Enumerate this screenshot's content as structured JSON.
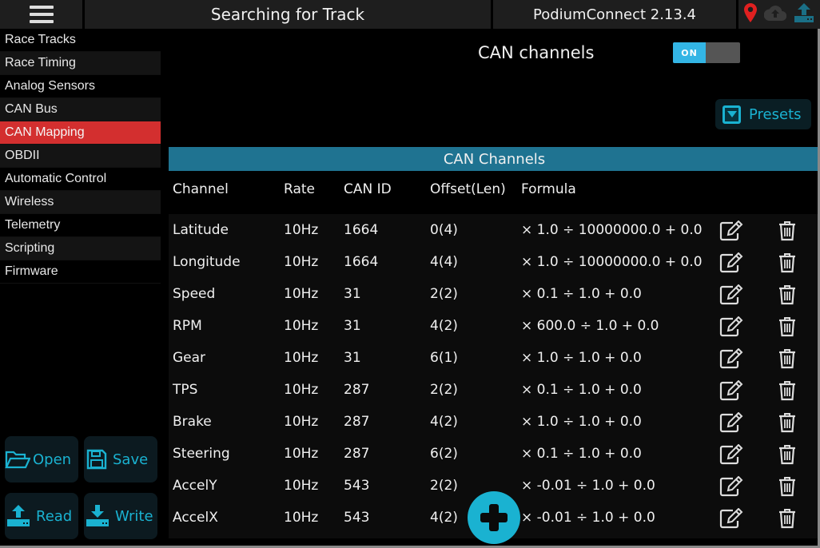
{
  "topbar": {
    "menu_icon": "hamburger-menu-icon",
    "title": "Searching for Track",
    "app_version": "PodiumConnect 2.13.4",
    "status_icons": [
      {
        "name": "location-pin-icon",
        "color": "#e02020"
      },
      {
        "name": "cloud-upload-icon",
        "color": "#3a3a3a"
      },
      {
        "name": "upload-icon",
        "color": "#1a6f86"
      }
    ]
  },
  "sidebar": {
    "items": [
      {
        "label": "Race Tracks",
        "active": false
      },
      {
        "label": "Race Timing",
        "active": false
      },
      {
        "label": "Analog Sensors",
        "active": false
      },
      {
        "label": "CAN Bus",
        "active": false
      },
      {
        "label": "CAN Mapping",
        "active": true
      },
      {
        "label": "OBDII",
        "active": false
      },
      {
        "label": "Automatic Control",
        "active": false
      },
      {
        "label": "Wireless",
        "active": false
      },
      {
        "label": "Telemetry",
        "active": false
      },
      {
        "label": "Scripting",
        "active": false
      },
      {
        "label": "Firmware",
        "active": false
      }
    ],
    "buttons": {
      "open": "Open",
      "save": "Save",
      "read": "Read",
      "write": "Write"
    }
  },
  "main": {
    "can_channels_label": "CAN channels",
    "toggle": {
      "label": "ON",
      "state": true
    },
    "presets_label": "Presets",
    "panel_title": "CAN Channels",
    "columns": {
      "channel": "Channel",
      "rate": "Rate",
      "can_id": "CAN ID",
      "offset": "Offset(Len)",
      "formula": "Formula"
    },
    "rows": [
      {
        "channel": "Latitude",
        "rate": "10Hz",
        "can_id": "1664",
        "offset": "0(4)",
        "formula": "× 1.0 ÷ 10000000.0 + 0.0"
      },
      {
        "channel": "Longitude",
        "rate": "10Hz",
        "can_id": "1664",
        "offset": "4(4)",
        "formula": "× 1.0 ÷ 10000000.0 + 0.0"
      },
      {
        "channel": "Speed",
        "rate": "10Hz",
        "can_id": "31",
        "offset": "2(2)",
        "formula": "× 0.1 ÷ 1.0 + 0.0"
      },
      {
        "channel": "RPM",
        "rate": "10Hz",
        "can_id": "31",
        "offset": "4(2)",
        "formula": "× 600.0 ÷ 1.0 + 0.0"
      },
      {
        "channel": "Gear",
        "rate": "10Hz",
        "can_id": "31",
        "offset": "6(1)",
        "formula": "× 1.0 ÷ 1.0 + 0.0"
      },
      {
        "channel": "TPS",
        "rate": "10Hz",
        "can_id": "287",
        "offset": "2(2)",
        "formula": "× 0.1 ÷ 1.0 + 0.0"
      },
      {
        "channel": "Brake",
        "rate": "10Hz",
        "can_id": "287",
        "offset": "4(2)",
        "formula": "× 1.0 ÷ 1.0 + 0.0"
      },
      {
        "channel": "Steering",
        "rate": "10Hz",
        "can_id": "287",
        "offset": "6(2)",
        "formula": "× 0.1 ÷ 1.0 + 0.0"
      },
      {
        "channel": "AccelY",
        "rate": "10Hz",
        "can_id": "543",
        "offset": "2(2)",
        "formula": "× -0.01 ÷ 1.0 + 0.0"
      },
      {
        "channel": "AccelX",
        "rate": "10Hz",
        "can_id": "543",
        "offset": "4(2)",
        "formula": "× -0.01 ÷ 1.0 + 0.0"
      }
    ],
    "row_icons": {
      "edit": "edit-icon",
      "delete": "trash-icon"
    },
    "fab_icon": "plus-icon"
  },
  "colors": {
    "accent": "#1ab2d1",
    "active_nav": "#d32f2f",
    "panel_header": "#1f7391",
    "toggle_on": "#33b5e5"
  }
}
